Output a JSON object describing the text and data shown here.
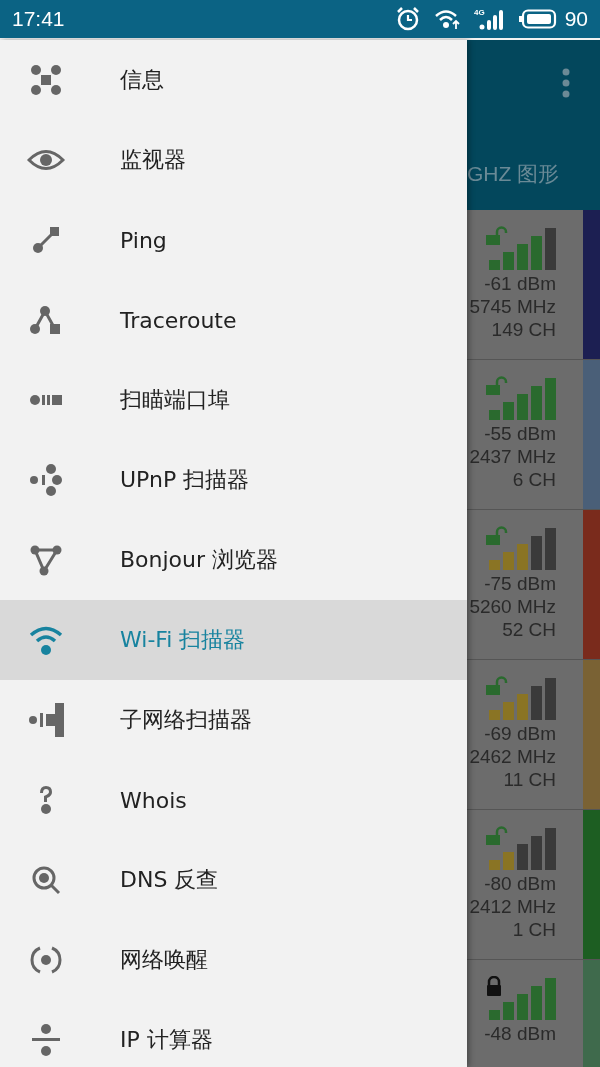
{
  "status_bar": {
    "time": "17:41",
    "network_type": "4G",
    "battery": "90"
  },
  "drawer": {
    "items": [
      {
        "label": "信息",
        "selected": false
      },
      {
        "label": "监视器",
        "selected": false
      },
      {
        "label": "Ping",
        "selected": false
      },
      {
        "label": "Traceroute",
        "selected": false
      },
      {
        "label": "扫瞄端口埠",
        "selected": false
      },
      {
        "label": "UPnP 扫描器",
        "selected": false
      },
      {
        "label": "Bonjour 浏览器",
        "selected": false
      },
      {
        "label": "Wi-Fi 扫描器",
        "selected": true
      },
      {
        "label": "子网络扫描器",
        "selected": false
      },
      {
        "label": "Whois",
        "selected": false
      },
      {
        "label": "DNS 反查",
        "selected": false
      },
      {
        "label": "网络唤醒",
        "selected": false
      },
      {
        "label": "IP 计算器",
        "selected": false
      }
    ]
  },
  "background_app": {
    "tab_label": "GHZ 图形",
    "networks": [
      {
        "kind": "good",
        "locked": false,
        "color": "#1c1f52",
        "signal": "-61 dBm",
        "frequency": "5745 MHz",
        "channel": "149 CH"
      },
      {
        "kind": "excellent",
        "locked": false,
        "color": "#4a5f78",
        "signal": "-55 dBm",
        "frequency": "2437 MHz",
        "channel": "6 CH"
      },
      {
        "kind": "fair",
        "locked": false,
        "color": "#7a2b1c",
        "signal": "-75 dBm",
        "frequency": "5260 MHz",
        "channel": "52 CH"
      },
      {
        "kind": "fair",
        "locked": false,
        "color": "#7a6234",
        "signal": "-69 dBm",
        "frequency": "2462 MHz",
        "channel": "11 CH"
      },
      {
        "kind": "weak",
        "locked": false,
        "color": "#1d5e22",
        "signal": "-80 dBm",
        "frequency": "2412 MHz",
        "channel": "1 CH"
      },
      {
        "kind": "excellent",
        "locked": true,
        "color": "#3f6a4c",
        "signal": "-48 dBm"
      }
    ]
  }
}
